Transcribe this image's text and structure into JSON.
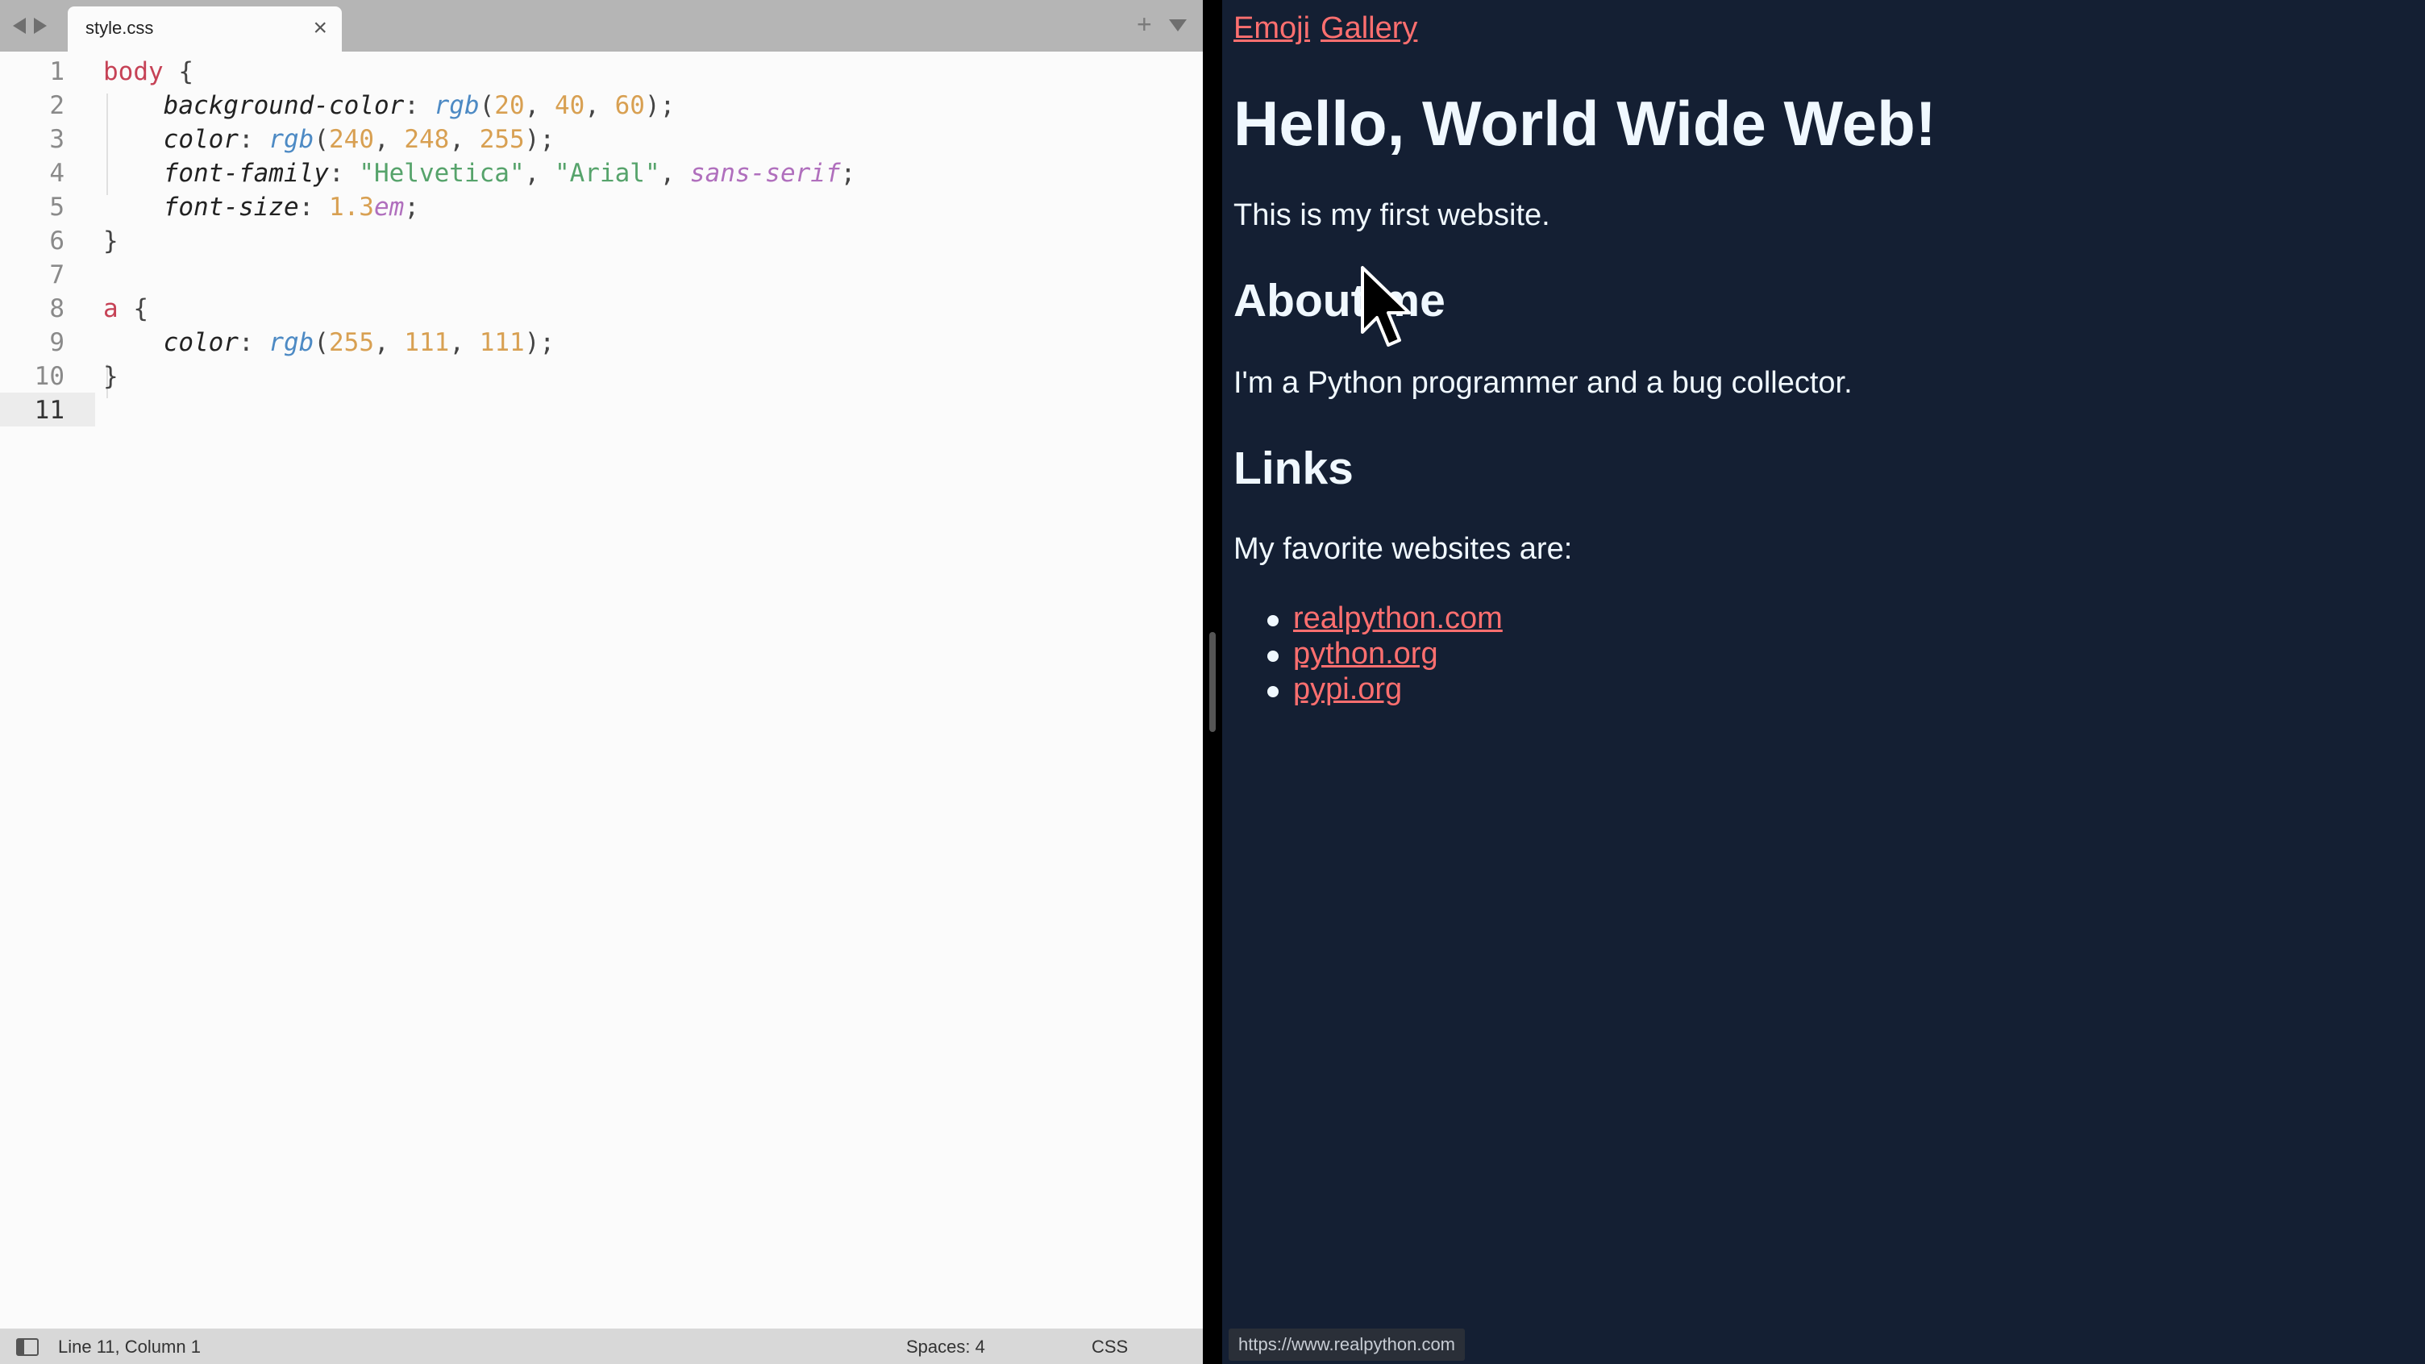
{
  "editor": {
    "tab_title": "style.css",
    "tab_close": "×",
    "tab_plus": "+",
    "line_numbers": [
      "1",
      "2",
      "3",
      "4",
      "5",
      "6",
      "7",
      "8",
      "9",
      "10",
      "11"
    ],
    "status": {
      "position": "Line 11, Column 1",
      "spaces": "Spaces: 4",
      "syntax": "CSS"
    }
  },
  "preview": {
    "nav": {
      "emoji": "Emoji",
      "gallery": "Gallery"
    },
    "h1": "Hello, World Wide Web!",
    "intro": "This is my first website.",
    "about_heading": "About me",
    "about_text": "I'm a Python programmer and a bug collector.",
    "links_heading": "Links",
    "links_intro": "My favorite websites are:",
    "links": [
      "realpython.com",
      "python.org",
      "pypi.org"
    ],
    "status_url": "https://www.realpython.com"
  },
  "colors": {
    "preview_bg": "#141f33",
    "preview_text": "#f0f8ff",
    "link": "#ff6f6f",
    "editor_bg": "#fbfbfb"
  }
}
